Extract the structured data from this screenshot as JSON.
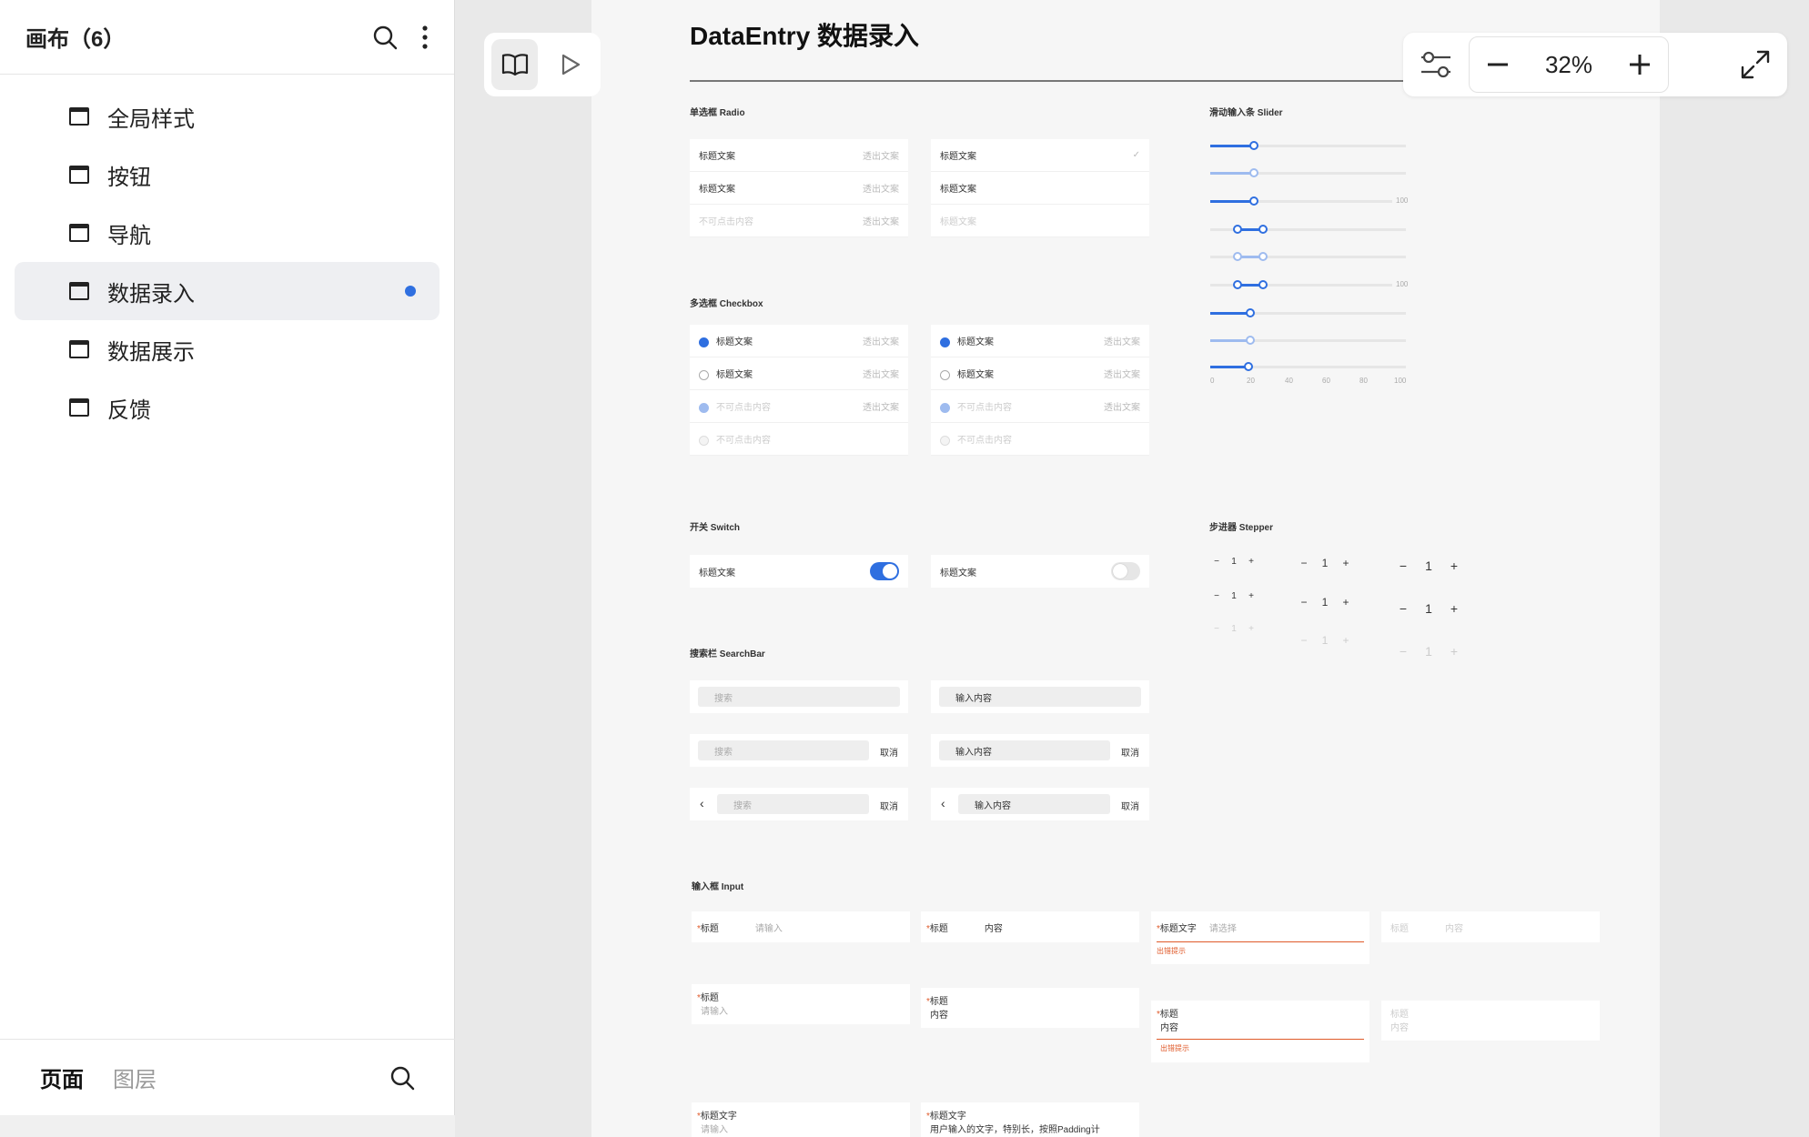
{
  "sidebar": {
    "title": "画布（6）",
    "pages": [
      {
        "label": "全局样式"
      },
      {
        "label": "按钮"
      },
      {
        "label": "导航"
      },
      {
        "label": "数据录入",
        "active": true
      },
      {
        "label": "数据展示"
      },
      {
        "label": "反馈"
      }
    ],
    "footer_tabs": [
      "页面",
      "图层"
    ]
  },
  "zoom": {
    "value": "32%"
  },
  "artboard": {
    "title": "DataEntry 数据录入",
    "radio": {
      "title": "单选框 Radio",
      "left_rows": [
        {
          "label": "标题文案",
          "right": "透出文案"
        },
        {
          "label": "标题文案",
          "right": "透出文案"
        },
        {
          "label": "不可点击内容",
          "right": "透出文案"
        }
      ],
      "right_rows": [
        {
          "label": "标题文案",
          "right": "✓"
        },
        {
          "label": "标题文案",
          "right": ""
        },
        {
          "label": "标题文案",
          "right": ""
        }
      ]
    },
    "checkbox": {
      "title": "多选框 Checkbox",
      "rows": [
        {
          "label": "标题文案",
          "right": "透出文案"
        },
        {
          "label": "标题文案",
          "right": "透出文案"
        },
        {
          "label": "不可点击内容",
          "right": "透出文案"
        },
        {
          "label": "不可点击内容",
          "right": ""
        }
      ]
    },
    "slider": {
      "title": "滑动输入条 Slider",
      "max_label": "100",
      "ticks": [
        "0",
        "20",
        "40",
        "60",
        "80",
        "100"
      ]
    },
    "switch": {
      "title": "开关 Switch",
      "label": "标题文案"
    },
    "stepper": {
      "title": "步进器 Stepper",
      "value": "1"
    },
    "searchbar": {
      "title": "搜索栏 SearchBar",
      "placeholder": "搜索",
      "filled": "输入内容",
      "cancel": "取消"
    },
    "input": {
      "title": "输入框 Input",
      "label": "标题",
      "label_long": "标题文字",
      "placeholder": "请输入",
      "select_placeholder": "请选择",
      "content": "内容",
      "error": "出错提示",
      "long_text": "用户输入的文字，特别长，按照Padding计"
    }
  }
}
